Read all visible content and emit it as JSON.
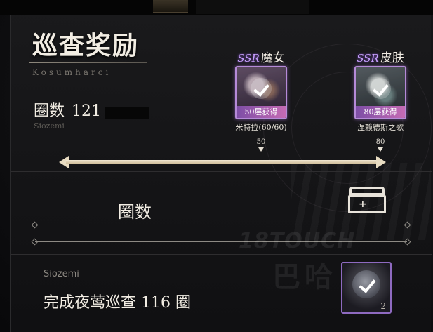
{
  "page": {
    "title": "巡查奖励",
    "subtitle": "Kosumharci"
  },
  "laps": {
    "label": "圈数",
    "value": "121",
    "sub": "Siozemi"
  },
  "rewards": [
    {
      "rarity": "SSR",
      "type": "魔女",
      "badge": "50层获得",
      "name": "米特拉(60/60)",
      "lap": "50",
      "icon": "witch-portrait-icon"
    },
    {
      "rarity": "SSR",
      "type": "皮肤",
      "badge": "80层获得",
      "name": "涅赖德斯之歌",
      "lap": "80",
      "icon": "skin-portrait-icon"
    }
  ],
  "section": {
    "title": "圈数",
    "icon": "chest-icon"
  },
  "task": {
    "sub": "Siozemi",
    "text": "完成夜莺巡查 116 圈",
    "reward_count": "2",
    "reward_icon": "orb-icon"
  },
  "watermark": {
    "line1": "18TOUCH",
    "line2": "巴哈"
  },
  "colors": {
    "ssr": "#c9a0ff",
    "card_border": "#b58ad8",
    "badge_gradient_start": "#7d4ea6",
    "badge_gradient_end": "#c56bb4",
    "progress": "#e8dcc2"
  }
}
